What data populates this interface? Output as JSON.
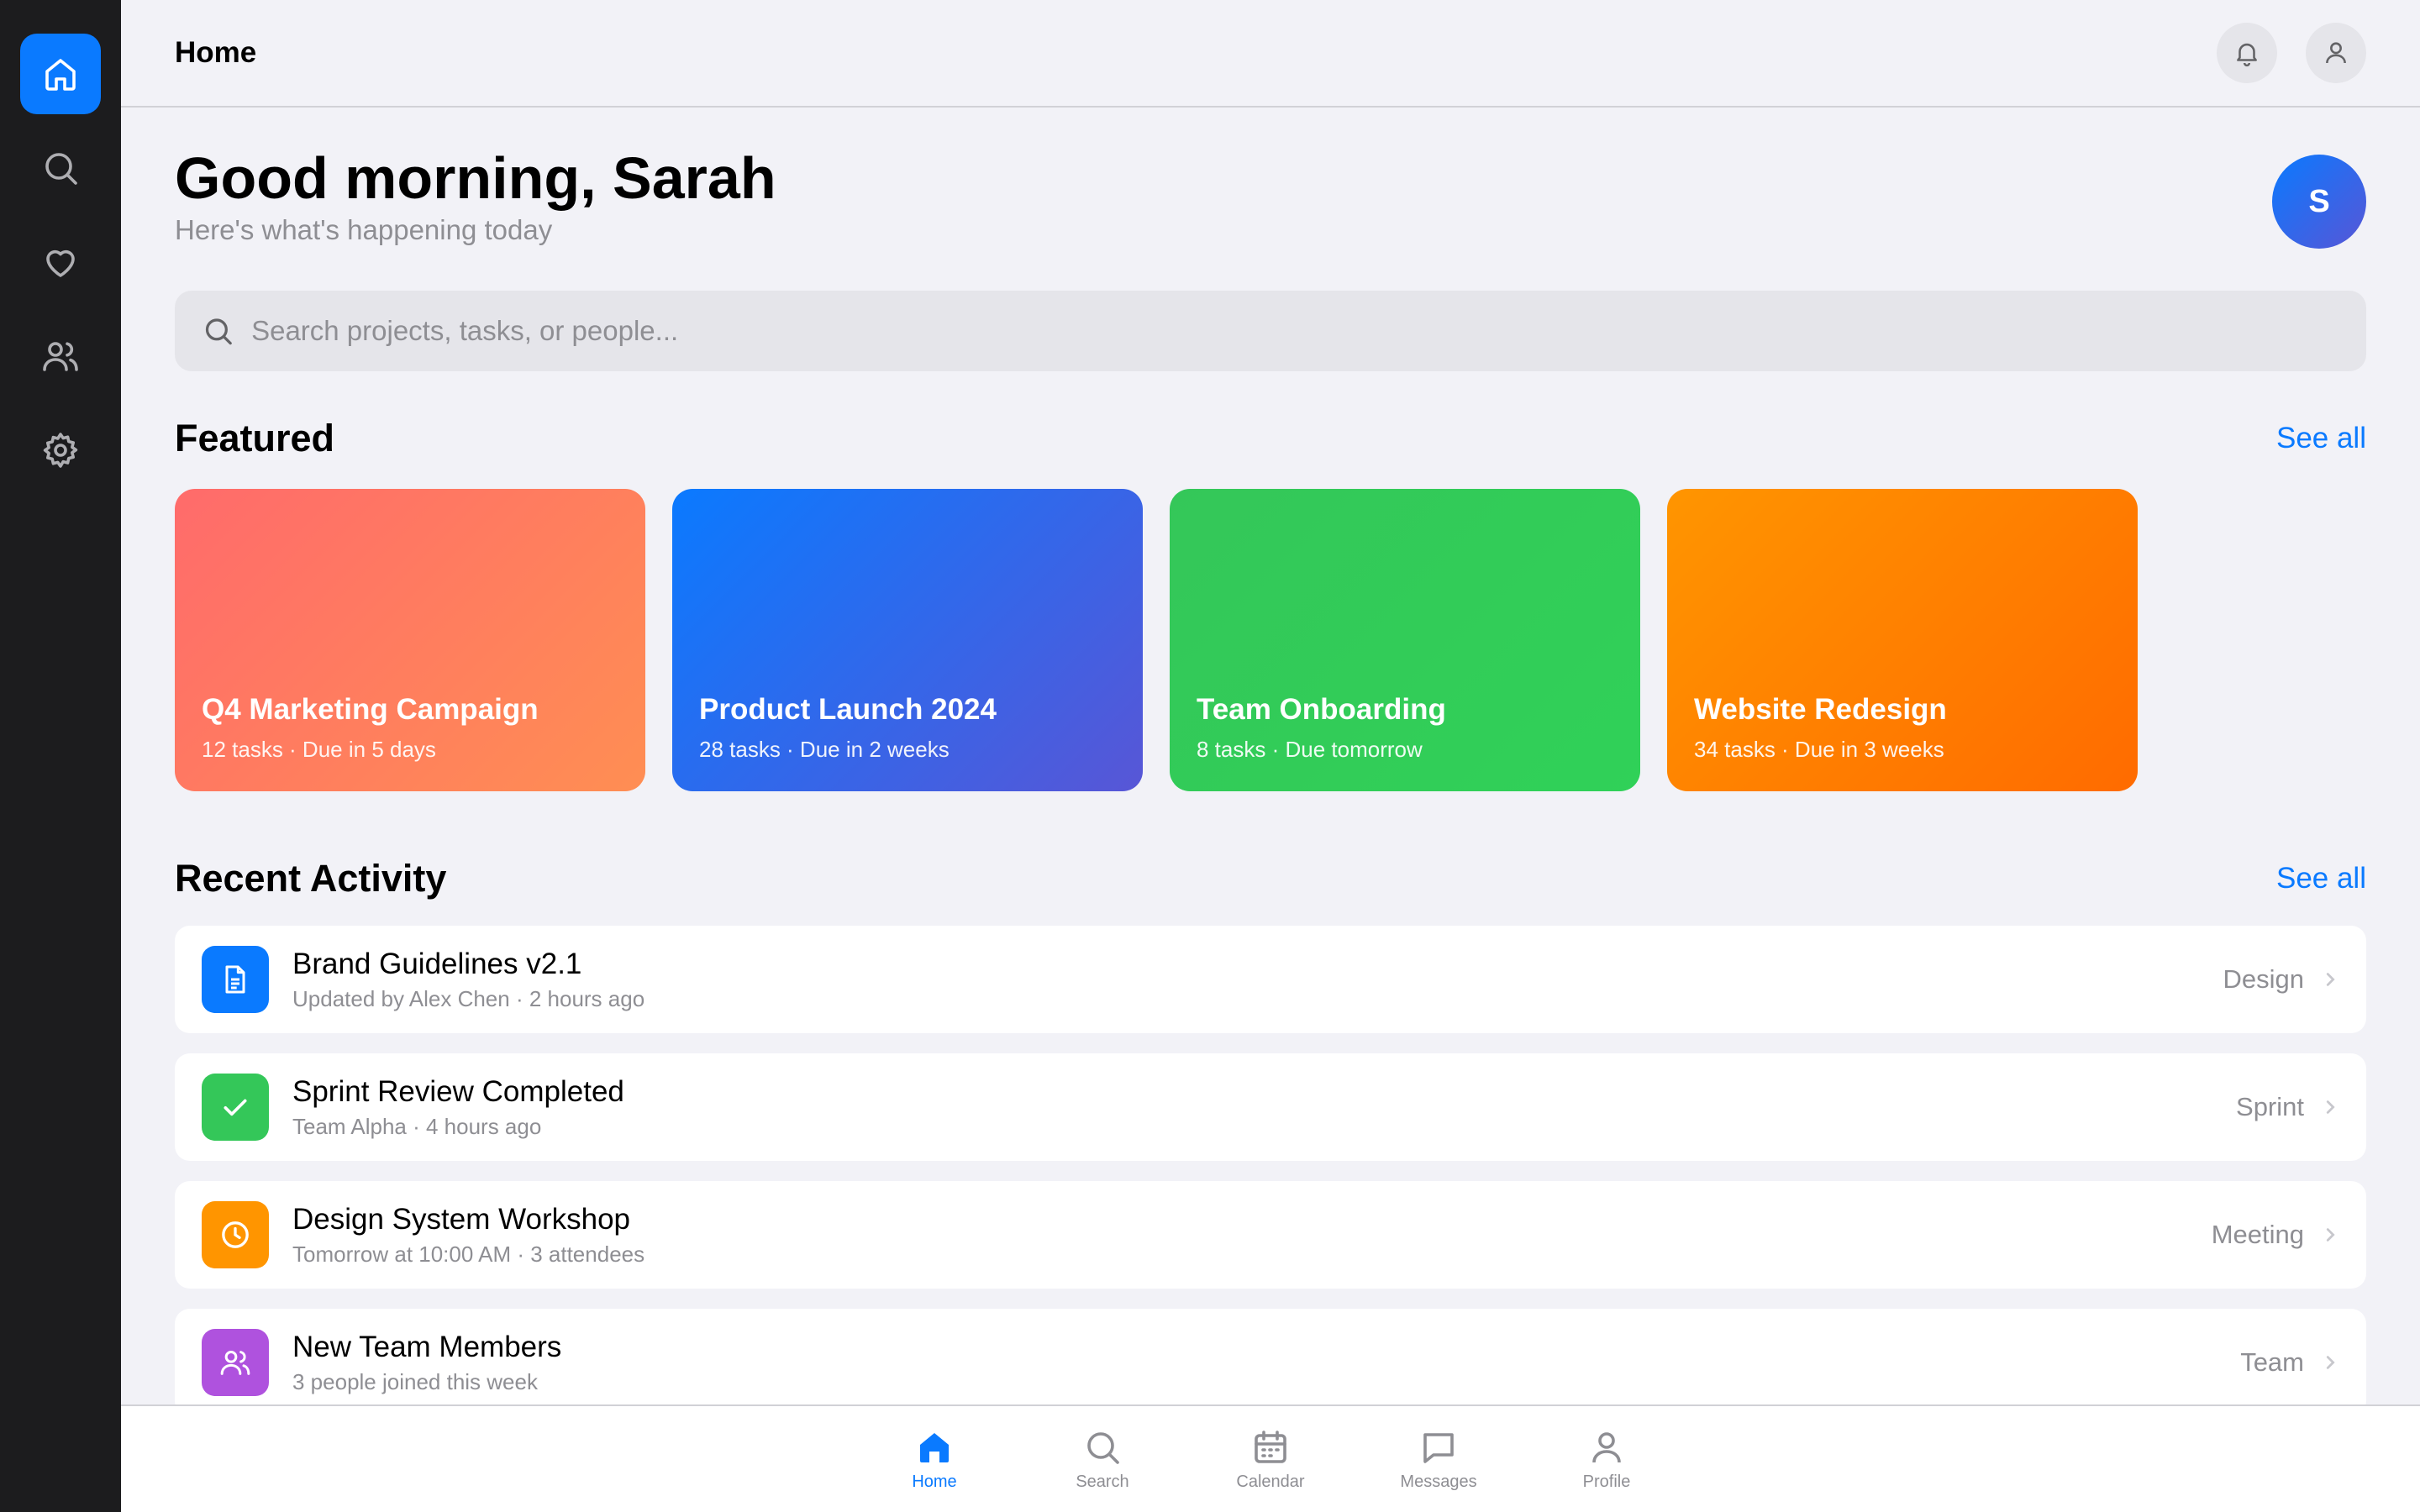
{
  "colors": {
    "accent": "#0a7aff",
    "sidebar_bg": "#1c1c1e",
    "background": "#f2f2f7"
  },
  "sidebar": {
    "items": [
      {
        "name": "home-icon",
        "active": true
      },
      {
        "name": "search-icon",
        "active": false
      },
      {
        "name": "heart-icon",
        "active": false
      },
      {
        "name": "users-icon",
        "active": false
      },
      {
        "name": "gear-icon",
        "active": false
      }
    ]
  },
  "header": {
    "title": "Home"
  },
  "greeting": {
    "title": "Good morning, Sarah",
    "subtitle": "Here's what's happening today",
    "avatar_initial": "S"
  },
  "search": {
    "placeholder": "Search projects, tasks, or people..."
  },
  "featured": {
    "title": "Featured",
    "see_all": "See all",
    "cards": [
      {
        "title": "Q4 Marketing Campaign",
        "meta": "12 tasks · Due in 5 days"
      },
      {
        "title": "Product Launch 2024",
        "meta": "28 tasks · Due in 2 weeks"
      },
      {
        "title": "Team Onboarding",
        "meta": "8 tasks · Due tomorrow"
      },
      {
        "title": "Website Redesign",
        "meta": "34 tasks · Due in 3 weeks"
      }
    ]
  },
  "activity": {
    "title": "Recent Activity",
    "see_all": "See all",
    "items": [
      {
        "title": "Brand Guidelines v2.1",
        "sub": "Updated by Alex Chen · 2 hours ago",
        "tag": "Design",
        "icon": "document-icon",
        "color": "#0a7aff"
      },
      {
        "title": "Sprint Review Completed",
        "sub": "Team Alpha · 4 hours ago",
        "tag": "Sprint",
        "icon": "checkmark-icon",
        "color": "#34c759"
      },
      {
        "title": "Design System Workshop",
        "sub": "Tomorrow at 10:00 AM · 3 attendees",
        "tag": "Meeting",
        "icon": "clock-icon",
        "color": "#ff9500"
      },
      {
        "title": "New Team Members",
        "sub": "3 people joined this week",
        "tag": "Team",
        "icon": "users-icon",
        "color": "#af52de"
      }
    ]
  },
  "tabbar": {
    "tabs": [
      {
        "label": "Home",
        "active": true
      },
      {
        "label": "Search",
        "active": false
      },
      {
        "label": "Calendar",
        "active": false
      },
      {
        "label": "Messages",
        "active": false
      },
      {
        "label": "Profile",
        "active": false
      }
    ]
  }
}
